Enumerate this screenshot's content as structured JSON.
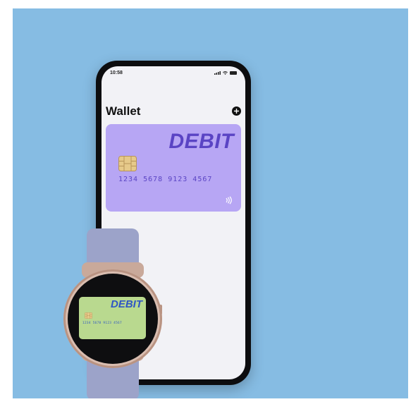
{
  "phone": {
    "status_bar": {
      "time": "10:58",
      "icons": [
        "signal-icon",
        "wifi-icon",
        "battery-icon"
      ]
    },
    "wallet": {
      "title": "Wallet",
      "add_icon": "plus-circle-icon"
    },
    "card": {
      "type_label": "DEBIT",
      "number": "1234 5678 9123 4567",
      "color": "#b7a6f4",
      "text_color": "#5a44c4",
      "icons": [
        "chip-icon",
        "contactless-icon"
      ]
    }
  },
  "watch": {
    "card": {
      "type_label": "DEBIT",
      "number": "1234 5678 9123 4567",
      "color": "#b9d98f",
      "text_color": "#2f56c4",
      "icons": [
        "chip-icon"
      ]
    }
  },
  "colors": {
    "background": "#86bce3",
    "band": "#9ca3c9",
    "case": "#d9bdb0"
  }
}
